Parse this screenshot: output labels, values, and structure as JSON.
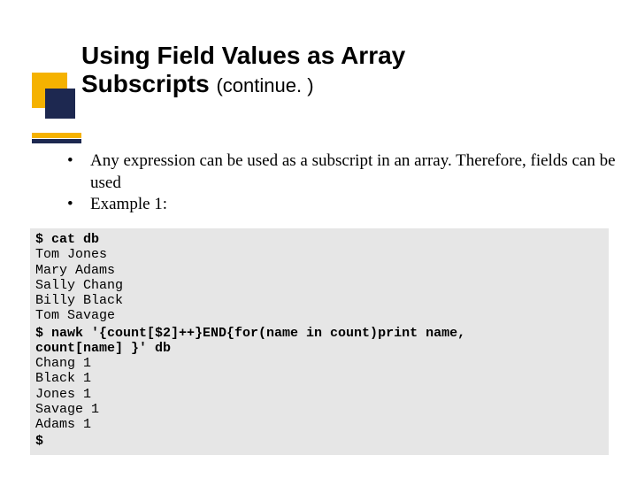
{
  "title": {
    "line1": "Using Field Values as Array",
    "line2_main": "Subscripts",
    "line2_sub": "(continue. )"
  },
  "bullets": [
    "Any expression can be used as a subscript in an array. Therefore, fields can be used",
    "Example 1:"
  ],
  "code": {
    "cmd1": "$ cat db",
    "out1": [
      "Tom Jones",
      "Mary Adams",
      "Sally Chang",
      "Billy Black",
      "Tom Savage"
    ],
    "cmd2_l1": "$ nawk '{count[$2]++}END{for(name in count)print name,",
    "cmd2_l2": "count[name] }' db",
    "out2": [
      "Chang 1",
      "Black 1",
      "Jones 1",
      "Savage 1",
      "Adams 1"
    ],
    "prompt": "$"
  }
}
